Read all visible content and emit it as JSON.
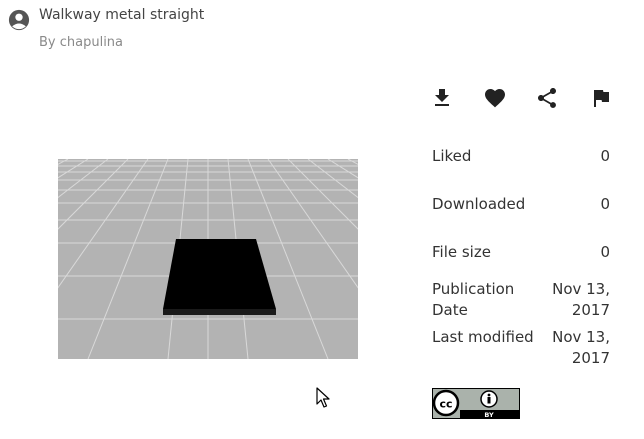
{
  "header": {
    "title": "Walkway metal straight",
    "author": "By chapulina"
  },
  "actions": {
    "download_icon": "download-icon",
    "like_icon": "heart-icon",
    "share_icon": "share-icon",
    "report_icon": "flag-icon"
  },
  "stats": {
    "liked_label": "Liked",
    "liked_value": "0",
    "downloaded_label": "Downloaded",
    "downloaded_value": "0",
    "file_size_label": "File size",
    "file_size_value": "0",
    "publication_label": "Publication Date",
    "publication_value": "Nov 13, 2017",
    "modified_label": "Last modified",
    "modified_value": "Nov 13, 2017"
  },
  "license": {
    "badge_text": "BY"
  },
  "colors": {
    "preview_background": "#b3b3b3",
    "grid_lines": "#d9d9d9",
    "model": "#000000"
  }
}
